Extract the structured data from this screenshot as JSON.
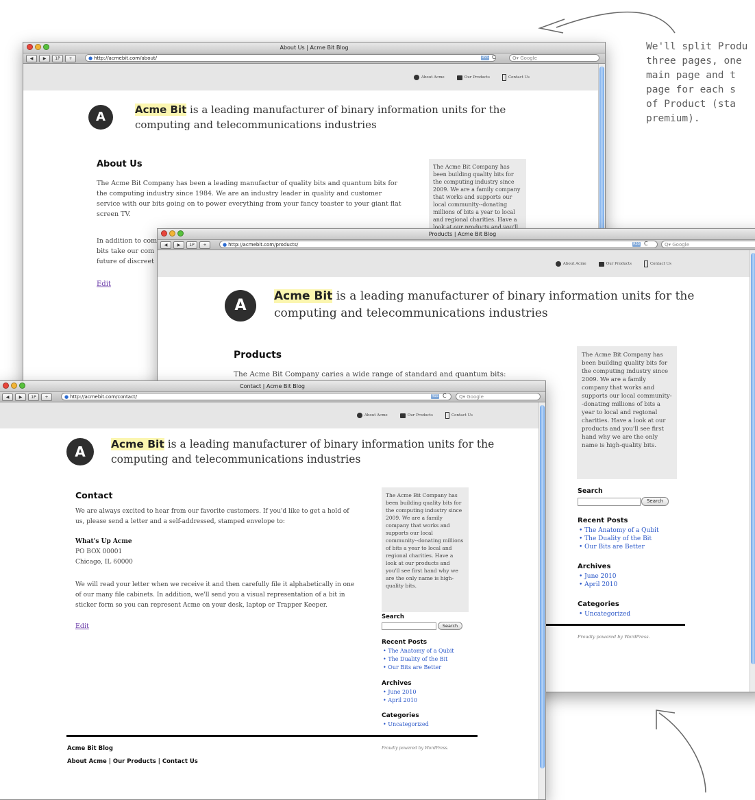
{
  "annotation": {
    "note_lines": [
      "We'll split Produ",
      "three pages, one",
      "main page and t",
      "page for each s",
      "of Product (sta",
      "premium)."
    ]
  },
  "browser": {
    "back": "◀",
    "fwd": "▶",
    "onepass": "1P",
    "plus": "+",
    "rss": "RSS",
    "reload": "C",
    "search_placeholder": "Q▾ Google"
  },
  "site": {
    "logo_letter": "A",
    "brand": "Acme Bit",
    "tagline": " is a leading manufacturer of binary information units for the",
    "tagline2": "computing and telecommunications industries",
    "nav": [
      "About Acme",
      "Our Products",
      "Contact Us"
    ],
    "edit": "Edit",
    "sidebar_text": "The Acme Bit Company has been building quality bits for the computing industry since 2009. We are a family company that works and supports our local community--donating millions of bits a year to local and regional charities. Have a look at our products and you'll see first hand why we are the only name is high-quality bits.",
    "search_heading": "Search",
    "search_button": "Search",
    "recent_heading": "Recent Posts",
    "recent": [
      "The Anatomy of a Qubit",
      "The Duality of the Bit",
      "Our Bits are Better"
    ],
    "archives_heading": "Archives",
    "archives": [
      "June 2010",
      "April 2010"
    ],
    "categories_heading": "Categories",
    "categories": [
      "Uncategorized"
    ],
    "credit": "Proudly powered by WordPress."
  },
  "about": {
    "title": "About Us | Acme Bit Blog",
    "url": "http://acmebit.com/about/",
    "heading": "About Us",
    "p1": "The Acme Bit Company has been a leading manufactur of quality bits and quantum bits for the computing industry since 1984. We are an industry leader in quality and customer service with our bits going on to power everything from your fancy toaster to your giant flat screen TV.",
    "p2a": "In addition to com",
    "p2b": "bits take our com",
    "p2c": "future of discreet"
  },
  "products": {
    "title": "Products | Acme Bit Blog",
    "url": "http://acmebit.com/products/",
    "heading": "Products",
    "p1": "The Acme Bit Company caries a wide range of standard and quantum bits:"
  },
  "contact": {
    "title": "Contact | Acme Bit Blog",
    "url": "http://acmebit.com/contact/",
    "heading": "Contact",
    "p1": "We are always excited to hear from our favorite customers. If you'd like to get a hold of us, please send a letter and a self-addressed, stamped envelope to:",
    "addr_name": "What's Up Acme",
    "addr1": "PO BOX 00001",
    "addr2": "Chicago, IL 60000",
    "p2": "We will read your letter when we receive it and then carefully file it alphabetically in one of our many file cabinets. In addition, we'll send you a visual representation of a bit in sticker form so you can represent Acme on your desk, laptop or Trapper Keeper.",
    "footer_title": "Acme Bit Blog",
    "footer_links": "About Acme | Our Products | Contact Us"
  }
}
